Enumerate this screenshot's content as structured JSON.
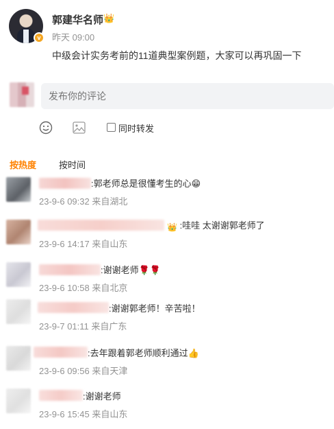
{
  "post": {
    "author": "郭建华名师",
    "time": "昨天 09:00",
    "text": "中级会计实务考前的11道典型案例题，大家可以再巩固一下",
    "verified_icon": "v",
    "crown_icon": "👑"
  },
  "composer": {
    "placeholder": "发布你的评论",
    "emoji_icon": "emoji-icon",
    "image_icon": "image-icon",
    "repost_label": "同时转发"
  },
  "tabs": {
    "hot": "按热度",
    "time": "按时间"
  },
  "comments": [
    {
      "text": ":郭老师总是很懂考生的心😁",
      "meta": "23-9-6 09:32 来自湖北"
    },
    {
      "text": ":哇哇 太谢谢郭老师了",
      "meta": "23-9-6 14:17 来自山东"
    },
    {
      "text": ":谢谢老师🌹🌹",
      "meta": "23-9-6 10:58 来自北京"
    },
    {
      "text": ":谢谢郭老师！辛苦啦！",
      "meta": "23-9-7 01:11 来自广东"
    },
    {
      "text": ":去年跟着郭老师顺利通过👍",
      "meta": "23-9-6 09:56 来自天津"
    },
    {
      "text": ":谢谢老师",
      "meta": "23-9-6 15:45 来自山东"
    }
  ],
  "colors": {
    "accent": "#ff8200",
    "meta": "#939393",
    "input_bg": "#f2f3f5"
  }
}
